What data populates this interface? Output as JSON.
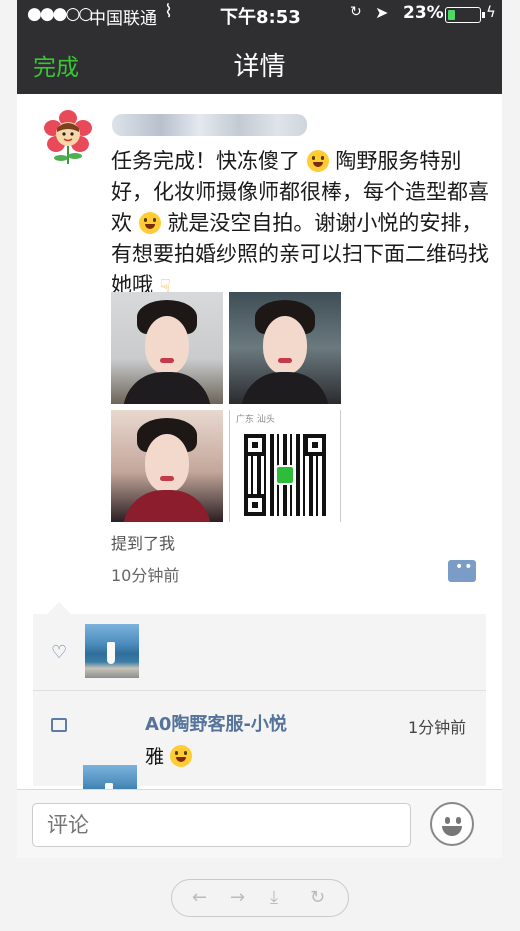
{
  "status_bar": {
    "signal": "●●●○○",
    "carrier": "中国联通",
    "time": "下午8:53",
    "battery_pct": "23%",
    "battery_level": 0.23
  },
  "navbar": {
    "done_label": "完成",
    "title": "详情"
  },
  "post": {
    "text_parts": [
      "任务完成！快冻傻了",
      "陶野服务特别好，化妆师摄像师都很棒，每个造型都喜欢",
      "就是没空自拍。谢谢小悦的安排，有想要拍婚纱照的亲可以扫下面二维码找她哦"
    ],
    "emoji_icons": [
      "tears-of-joy-emoji",
      "tongue-out-emoji",
      "pointing-down-emoji"
    ],
    "mention": "提到了我",
    "time_ago": "10分钟前",
    "qr_header": "广东 汕头"
  },
  "comments": [
    {
      "author": "A0陶野客服-小悦",
      "time": "1分钟前",
      "text": "雅",
      "emoji_icon": "heart-eyes-emoji"
    }
  ],
  "input": {
    "placeholder": "评论"
  },
  "colors": {
    "nav_bg": "#2f2f31",
    "done_green": "#38c734",
    "link_blue": "#56739a"
  }
}
